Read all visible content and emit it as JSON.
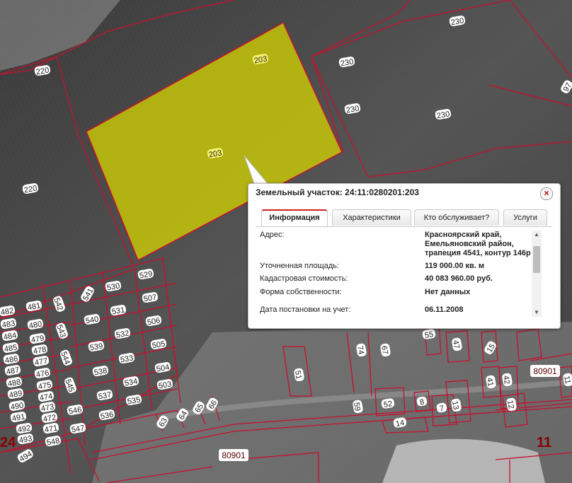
{
  "map": {
    "parcel_labels": {
      "p230a": "230",
      "p230b": "230",
      "p230c": "230",
      "p230d": "230",
      "p220a": "220",
      "p220b": "220",
      "p203a": "203",
      "p203b": "203",
      "p97": "97",
      "p529": "529",
      "p541": "541",
      "p530": "530",
      "p507": "507",
      "p542": "542",
      "p481": "481",
      "p482": "482",
      "p483": "483",
      "p484": "484",
      "p485": "485",
      "p486": "486",
      "p487": "487",
      "p488": "488",
      "p489": "489",
      "p490": "490",
      "p491": "491",
      "p492": "492",
      "p493": "493",
      "p494": "494",
      "p480": "480",
      "p479": "479",
      "p478": "478",
      "p477": "477",
      "p476": "476",
      "p475": "475",
      "p474": "474",
      "p473": "473",
      "p472": "472",
      "p471": "471",
      "p540": "540",
      "p531": "531",
      "p506": "506",
      "p543": "543",
      "p532": "532",
      "p539": "539",
      "p505": "505",
      "p544": "544",
      "p533": "533",
      "p538": "538",
      "p504": "504",
      "p545": "545",
      "p534": "534",
      "p537": "537",
      "p503": "503",
      "p546": "546",
      "p535": "535",
      "p536": "536",
      "p547": "547",
      "p548": "548",
      "p51": "51",
      "p52": "52",
      "p8": "8",
      "p7": "7",
      "p13": "13",
      "p14": "14",
      "p41": "41",
      "p42": "42",
      "p15": "15",
      "p12": "12",
      "p11": "11",
      "p59": "59",
      "p55": "55",
      "p47": "47",
      "p74": "74",
      "p67": "67",
      "p80901a": "80901",
      "p80901b": "80901",
      "p24": "24",
      "p11big": "11"
    }
  },
  "popup": {
    "title": "Земельный участок: 24:11:0280201:203",
    "close_symbol": "×",
    "tabs": [
      "Информация",
      "Характеристики",
      "Кто обслуживает?",
      "Услуги"
    ],
    "rows": [
      {
        "label": "Адрес:",
        "value": "Красноярский край, Емельяновский район, трапеция 4541, контур 146р"
      },
      {
        "label": "Уточненная площадь:",
        "value": "119 000.00 кв. м"
      },
      {
        "label": "Кадастровая стоимость:",
        "value": "40 083 960.00 руб."
      },
      {
        "label": "Форма собственности:",
        "value": "Нет данных"
      },
      {
        "label": "Дата постановки на учет:",
        "value": "06.11.2008"
      }
    ],
    "scroll_up": "▲",
    "scroll_down": "▼"
  },
  "colors": {
    "boundary": "#c8102e",
    "selected_fill": "#d6d400",
    "popup_active_tab": "#d02020"
  }
}
